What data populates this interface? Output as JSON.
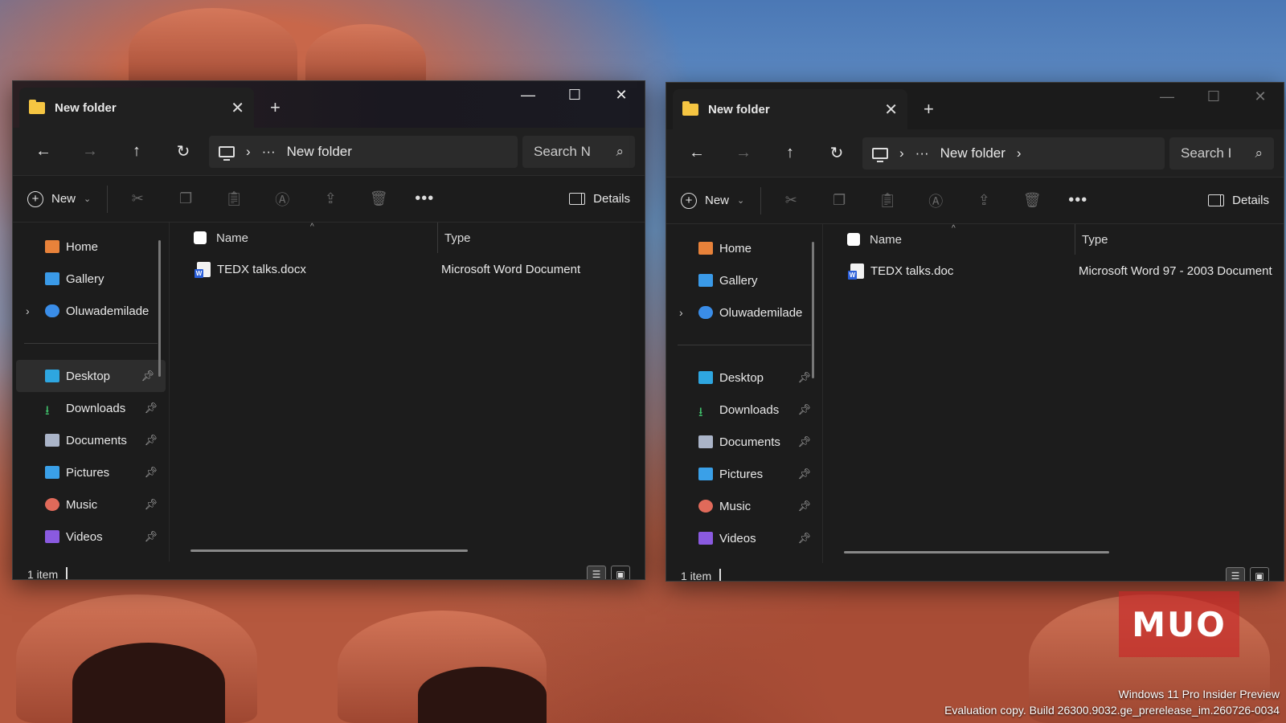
{
  "windows": [
    {
      "tab_title": "New folder",
      "breadcrumb": "New folder",
      "breadcrumb_trailing_chevron": false,
      "search_placeholder": "Search N",
      "new_label": "New",
      "details_label": "Details",
      "columns": {
        "name": "Name",
        "type": "Type"
      },
      "files": [
        {
          "name": "TEDX talks.docx",
          "type": "Microsoft Word Document"
        }
      ],
      "status": "1 item",
      "active": true
    },
    {
      "tab_title": "New folder",
      "breadcrumb": "New folder",
      "breadcrumb_trailing_chevron": true,
      "search_placeholder": "Search I",
      "new_label": "New",
      "details_label": "Details",
      "columns": {
        "name": "Name",
        "type": "Type"
      },
      "files": [
        {
          "name": "TEDX talks.doc",
          "type": "Microsoft Word 97 - 2003 Document"
        }
      ],
      "status": "1 item",
      "active": false
    }
  ],
  "sidebar": {
    "items": [
      {
        "label": "Home",
        "icon": "home-icon",
        "color": "#e8823a",
        "pinned": false,
        "expandable": false
      },
      {
        "label": "Gallery",
        "icon": "gallery-icon",
        "color": "#3a9ae8",
        "pinned": false,
        "expandable": false
      },
      {
        "label": "Oluwademilade",
        "icon": "onedrive-cloud-icon",
        "color": "#3a8de8",
        "pinned": false,
        "expandable": true
      }
    ],
    "quick_access": [
      {
        "label": "Desktop",
        "icon": "desktop-icon",
        "color": "#2ea6e0"
      },
      {
        "label": "Downloads",
        "icon": "downloads-icon",
        "color": "#3fbf6a"
      },
      {
        "label": "Documents",
        "icon": "documents-icon",
        "color": "#aab4c8"
      },
      {
        "label": "Pictures",
        "icon": "pictures-icon",
        "color": "#3aa0e8"
      },
      {
        "label": "Music",
        "icon": "music-icon",
        "color": "#e06a5a"
      },
      {
        "label": "Videos",
        "icon": "videos-icon",
        "color": "#8a5ae0"
      }
    ]
  },
  "watermark": {
    "line1": "Windows 11 Pro Insider Preview",
    "line2": "Evaluation copy. Build 26300.9032.ge_prerelease_im.260726-0034"
  },
  "logo_text": "MUO"
}
